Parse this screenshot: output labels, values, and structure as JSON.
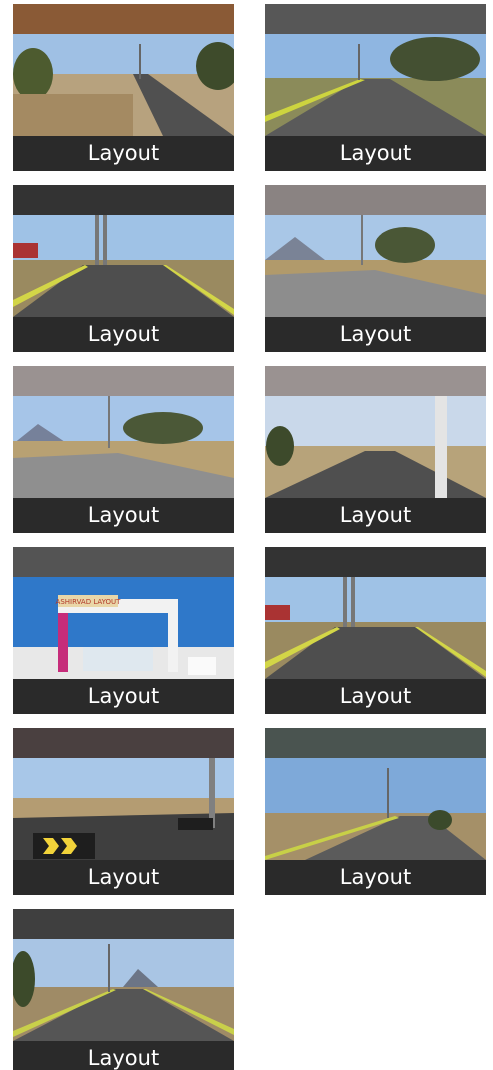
{
  "gallery": {
    "items": [
      {
        "caption": "Layout",
        "band": "#8a5a36",
        "scene": "road-left"
      },
      {
        "caption": "Layout",
        "band": "#575757",
        "scene": "road-curb"
      },
      {
        "caption": "Layout",
        "band": "#333333",
        "scene": "road-tower"
      },
      {
        "caption": "Layout",
        "band": "#8a8382",
        "scene": "road-hills"
      },
      {
        "caption": "Layout",
        "band": "#9a9291",
        "scene": "road-hills"
      },
      {
        "caption": "Layout",
        "band": "#9a9291",
        "scene": "road-pole"
      },
      {
        "caption": "Layout",
        "band": "#545454",
        "scene": "arch"
      },
      {
        "caption": "Layout",
        "band": "#333333",
        "scene": "road-tower"
      },
      {
        "caption": "Layout",
        "band": "#4a4040",
        "scene": "road-chevron"
      },
      {
        "caption": "Layout",
        "band": "#4a5450",
        "scene": "road-right"
      },
      {
        "caption": "Layout",
        "band": "#3f3f3f",
        "scene": "road-far"
      }
    ],
    "arch_text": "ASHIRVAD LAYOUT"
  }
}
